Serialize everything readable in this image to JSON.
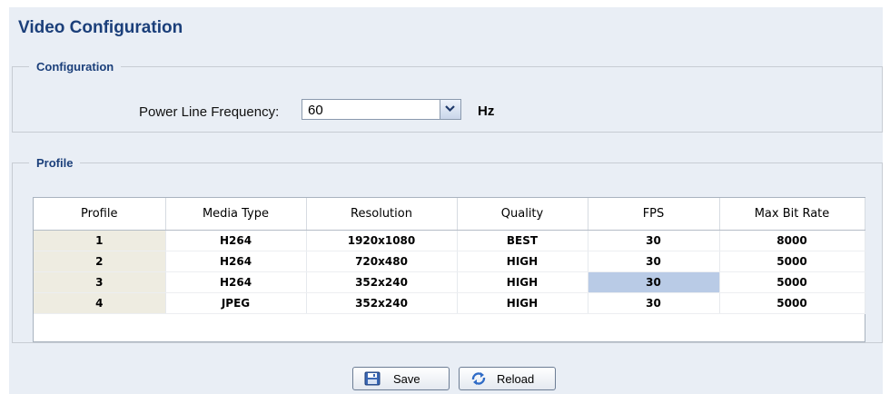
{
  "page": {
    "title": "Video Configuration"
  },
  "configuration": {
    "legend": "Configuration",
    "power_line_label": "Power Line Frequency:",
    "power_line_value": "60",
    "unit": "Hz"
  },
  "profile": {
    "legend": "Profile",
    "columns": [
      "Profile",
      "Media Type",
      "Resolution",
      "Quality",
      "FPS",
      "Max Bit Rate"
    ],
    "rows": [
      [
        "1",
        "H264",
        "1920x1080",
        "BEST",
        "30",
        "8000"
      ],
      [
        "2",
        "H264",
        "720x480",
        "HIGH",
        "30",
        "5000"
      ],
      [
        "3",
        "H264",
        "352x240",
        "HIGH",
        "30",
        "5000"
      ],
      [
        "4",
        "JPEG",
        "352x240",
        "HIGH",
        "30",
        "5000"
      ]
    ]
  },
  "buttons": {
    "save": "Save",
    "reload": "Reload"
  },
  "colors": {
    "title": "#1b3f7a",
    "selected_cell": "#b9cbe6",
    "panel_bg": "#e9eef5"
  }
}
